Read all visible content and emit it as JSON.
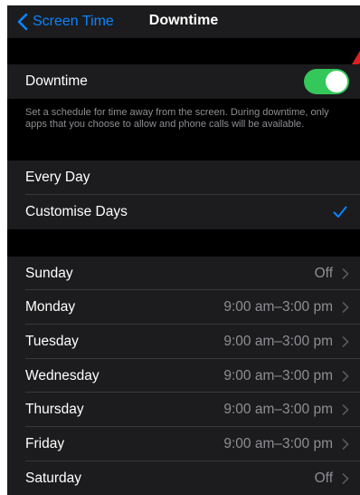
{
  "nav": {
    "back_label": "Screen Time",
    "title": "Downtime"
  },
  "downtime": {
    "label": "Downtime",
    "enabled": true,
    "description": "Set a schedule for time away from the screen. During downtime, only apps that you choose to allow and phone calls will be available."
  },
  "schedule": {
    "options": [
      {
        "label": "Every Day",
        "selected": false
      },
      {
        "label": "Customise Days",
        "selected": true
      }
    ]
  },
  "days": [
    {
      "day": "Sunday",
      "value": "Off"
    },
    {
      "day": "Monday",
      "value": "9:00 am–3:00 pm"
    },
    {
      "day": "Tuesday",
      "value": "9:00 am–3:00 pm"
    },
    {
      "day": "Wednesday",
      "value": "9:00 am–3:00 pm"
    },
    {
      "day": "Thursday",
      "value": "9:00 am–3:00 pm"
    },
    {
      "day": "Friday",
      "value": "9:00 am–3:00 pm"
    },
    {
      "day": "Saturday",
      "value": "Off"
    }
  ],
  "icons": {
    "back": "chevron-left-icon",
    "check": "checkmark-icon",
    "disclosure": "chevron-right-icon"
  },
  "colors": {
    "accent": "#0a84ff",
    "toggle_on": "#34c759",
    "background": "#000000",
    "cell": "#1c1c1e",
    "secondary_text": "#8e8e93"
  }
}
